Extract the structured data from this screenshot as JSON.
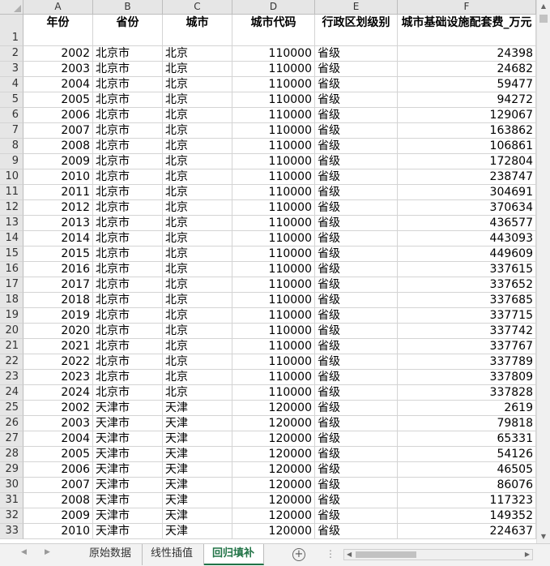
{
  "columns": [
    "A",
    "B",
    "C",
    "D",
    "E",
    "F"
  ],
  "header_row": {
    "num": "1",
    "cells": [
      "年份",
      "省份",
      "城市",
      "城市代码",
      "行政区划级别",
      "城市基础设施配套费_万元"
    ]
  },
  "rows": [
    {
      "n": "2",
      "cells": [
        "2002",
        "北京市",
        "北京",
        "110000",
        "省级",
        "24398"
      ]
    },
    {
      "n": "3",
      "cells": [
        "2003",
        "北京市",
        "北京",
        "110000",
        "省级",
        "24682"
      ]
    },
    {
      "n": "4",
      "cells": [
        "2004",
        "北京市",
        "北京",
        "110000",
        "省级",
        "59477"
      ]
    },
    {
      "n": "5",
      "cells": [
        "2005",
        "北京市",
        "北京",
        "110000",
        "省级",
        "94272"
      ]
    },
    {
      "n": "6",
      "cells": [
        "2006",
        "北京市",
        "北京",
        "110000",
        "省级",
        "129067"
      ]
    },
    {
      "n": "7",
      "cells": [
        "2007",
        "北京市",
        "北京",
        "110000",
        "省级",
        "163862"
      ]
    },
    {
      "n": "8",
      "cells": [
        "2008",
        "北京市",
        "北京",
        "110000",
        "省级",
        "106861"
      ]
    },
    {
      "n": "9",
      "cells": [
        "2009",
        "北京市",
        "北京",
        "110000",
        "省级",
        "172804"
      ]
    },
    {
      "n": "10",
      "cells": [
        "2010",
        "北京市",
        "北京",
        "110000",
        "省级",
        "238747"
      ]
    },
    {
      "n": "11",
      "cells": [
        "2011",
        "北京市",
        "北京",
        "110000",
        "省级",
        "304691"
      ]
    },
    {
      "n": "12",
      "cells": [
        "2012",
        "北京市",
        "北京",
        "110000",
        "省级",
        "370634"
      ]
    },
    {
      "n": "13",
      "cells": [
        "2013",
        "北京市",
        "北京",
        "110000",
        "省级",
        "436577"
      ]
    },
    {
      "n": "14",
      "cells": [
        "2014",
        "北京市",
        "北京",
        "110000",
        "省级",
        "443093"
      ]
    },
    {
      "n": "15",
      "cells": [
        "2015",
        "北京市",
        "北京",
        "110000",
        "省级",
        "449609"
      ]
    },
    {
      "n": "16",
      "cells": [
        "2016",
        "北京市",
        "北京",
        "110000",
        "省级",
        "337615"
      ]
    },
    {
      "n": "17",
      "cells": [
        "2017",
        "北京市",
        "北京",
        "110000",
        "省级",
        "337652"
      ]
    },
    {
      "n": "18",
      "cells": [
        "2018",
        "北京市",
        "北京",
        "110000",
        "省级",
        "337685"
      ]
    },
    {
      "n": "19",
      "cells": [
        "2019",
        "北京市",
        "北京",
        "110000",
        "省级",
        "337715"
      ]
    },
    {
      "n": "20",
      "cells": [
        "2020",
        "北京市",
        "北京",
        "110000",
        "省级",
        "337742"
      ]
    },
    {
      "n": "21",
      "cells": [
        "2021",
        "北京市",
        "北京",
        "110000",
        "省级",
        "337767"
      ]
    },
    {
      "n": "22",
      "cells": [
        "2022",
        "北京市",
        "北京",
        "110000",
        "省级",
        "337789"
      ]
    },
    {
      "n": "23",
      "cells": [
        "2023",
        "北京市",
        "北京",
        "110000",
        "省级",
        "337809"
      ]
    },
    {
      "n": "24",
      "cells": [
        "2024",
        "北京市",
        "北京",
        "110000",
        "省级",
        "337828"
      ]
    },
    {
      "n": "25",
      "cells": [
        "2002",
        "天津市",
        "天津",
        "120000",
        "省级",
        "2619"
      ]
    },
    {
      "n": "26",
      "cells": [
        "2003",
        "天津市",
        "天津",
        "120000",
        "省级",
        "79818"
      ]
    },
    {
      "n": "27",
      "cells": [
        "2004",
        "天津市",
        "天津",
        "120000",
        "省级",
        "65331"
      ]
    },
    {
      "n": "28",
      "cells": [
        "2005",
        "天津市",
        "天津",
        "120000",
        "省级",
        "54126"
      ]
    },
    {
      "n": "29",
      "cells": [
        "2006",
        "天津市",
        "天津",
        "120000",
        "省级",
        "46505"
      ]
    },
    {
      "n": "30",
      "cells": [
        "2007",
        "天津市",
        "天津",
        "120000",
        "省级",
        "86076"
      ]
    },
    {
      "n": "31",
      "cells": [
        "2008",
        "天津市",
        "天津",
        "120000",
        "省级",
        "117323"
      ]
    },
    {
      "n": "32",
      "cells": [
        "2009",
        "天津市",
        "天津",
        "120000",
        "省级",
        "149352"
      ]
    },
    {
      "n": "33",
      "cells": [
        "2010",
        "天津市",
        "天津",
        "120000",
        "省级",
        "224637"
      ]
    }
  ],
  "tabs": [
    {
      "label": "原始数据",
      "active": false
    },
    {
      "label": "线性插值",
      "active": false
    },
    {
      "label": "回归填补",
      "active": true
    }
  ],
  "accent_color": "#217346"
}
